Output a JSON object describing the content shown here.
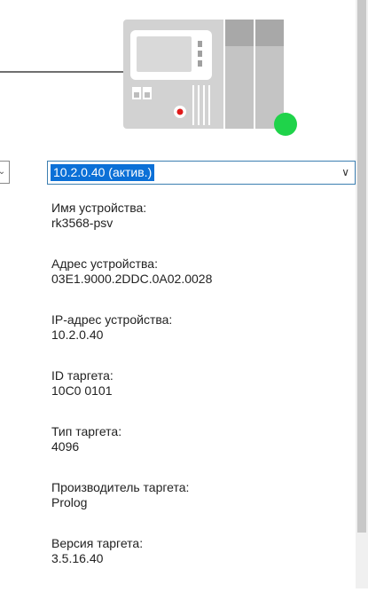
{
  "device_image": {
    "icon": "plc-device-icon",
    "status": "online",
    "status_color": "#1fd34a"
  },
  "left_dropdown": {
    "icon": "chevron-down-icon",
    "glyph": "⌄"
  },
  "device_select": {
    "value": "10.2.0.40 (актив.)",
    "chevron": "∨"
  },
  "device_info": [
    {
      "label": "Имя устройства:",
      "value": "rk3568-psv"
    },
    {
      "label": "Адрес устройства:",
      "value": "03E1.9000.2DDC.0A02.0028"
    },
    {
      "label": "IP-адрес устройства:",
      "value": "10.2.0.40"
    },
    {
      "label": "ID таргета:",
      "value": "10C0  0101"
    },
    {
      "label": "Тип таргета:",
      "value": "4096"
    },
    {
      "label": "Производитель таргета:",
      "value": "Prolog"
    },
    {
      "label": "Версия таргета:",
      "value": "3.5.16.40"
    }
  ]
}
